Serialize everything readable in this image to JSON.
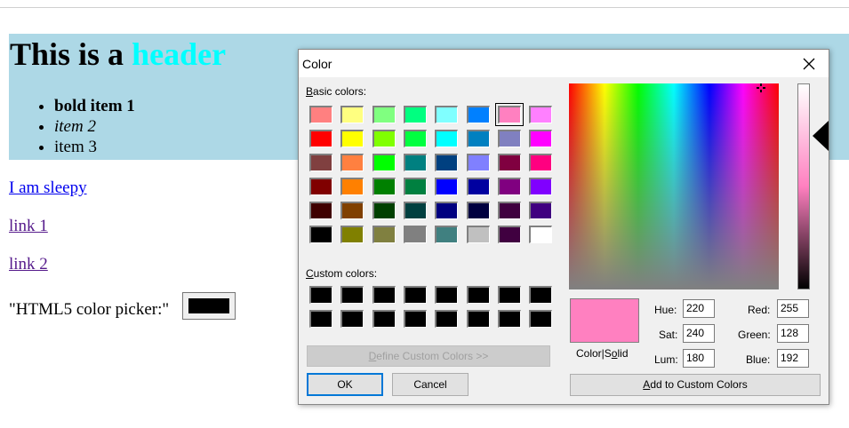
{
  "page": {
    "header_plain": "This is a ",
    "header_highlight": "header",
    "list_items": [
      "bold item 1",
      "item 2",
      "item 3"
    ],
    "links": [
      "I am sleepy",
      "link 1",
      "link 2"
    ],
    "picker_label": "\"HTML5 color picker:\"",
    "picker_value_color": "#000000"
  },
  "dialog": {
    "title": "Color",
    "close_icon": "close-x-icon",
    "basic_colors_label": "Basic colors:",
    "custom_colors_label": "Custom colors:",
    "basic_colors": [
      [
        "#ff8080",
        "#ffff80",
        "#80ff80",
        "#00ff80",
        "#80ffff",
        "#0080ff",
        "#ff80c0",
        "#ff80ff"
      ],
      [
        "#ff0000",
        "#ffff00",
        "#80ff00",
        "#00ff40",
        "#00ffff",
        "#0080c0",
        "#8080c0",
        "#ff00ff"
      ],
      [
        "#804040",
        "#ff8040",
        "#00ff00",
        "#008080",
        "#004080",
        "#8080ff",
        "#800040",
        "#ff0080"
      ],
      [
        "#800000",
        "#ff8000",
        "#008000",
        "#008040",
        "#0000ff",
        "#0000a0",
        "#800080",
        "#8000ff"
      ],
      [
        "#400000",
        "#804000",
        "#004000",
        "#004040",
        "#000080",
        "#000040",
        "#400040",
        "#400080"
      ],
      [
        "#000000",
        "#808000",
        "#808040",
        "#808080",
        "#408080",
        "#c0c0c0",
        "#400040",
        "#ffffff"
      ]
    ],
    "selected_basic": [
      0,
      6
    ],
    "custom_colors": [
      [
        "#000000",
        "#000000",
        "#000000",
        "#000000",
        "#000000",
        "#000000",
        "#000000",
        "#000000"
      ],
      [
        "#000000",
        "#000000",
        "#000000",
        "#000000",
        "#000000",
        "#000000",
        "#000000",
        "#000000"
      ]
    ],
    "define_custom_btn": "Define Custom Colors >>",
    "ok_btn": "OK",
    "cancel_btn": "Cancel",
    "add_custom_btn": "Add to Custom Colors",
    "color_solid_label": "Color|Solid",
    "preview_color": "#ff80c0",
    "hue_label": "Hue:",
    "hue": "220",
    "sat_label": "Sat:",
    "sat": "240",
    "lum_label": "Lum:",
    "lum": "180",
    "red_label": "Red:",
    "red": "255",
    "green_label": "Green:",
    "green": "128",
    "blue_label": "Blue:",
    "blue": "192"
  }
}
